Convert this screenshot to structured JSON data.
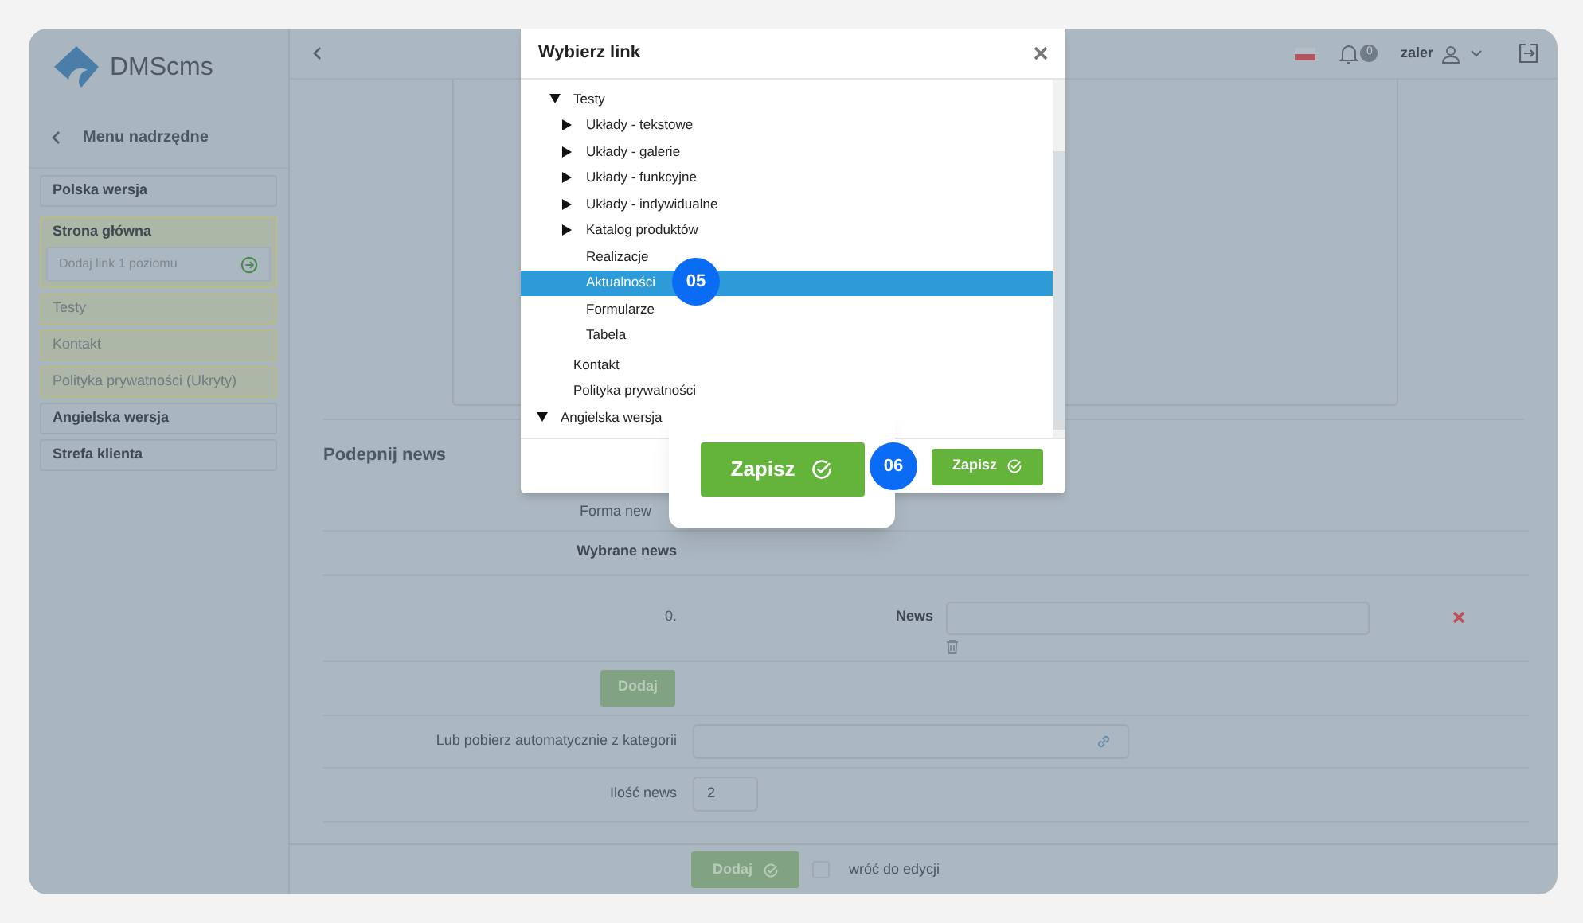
{
  "sidebar": {
    "logo": "DMScms",
    "back": "Menu nadrzędne",
    "items": [
      {
        "kind": "section",
        "label": "Polska wersja"
      },
      {
        "kind": "group",
        "label": "Strona główna",
        "field": {
          "placeholder": "Dodaj link 1 poziomu"
        }
      },
      {
        "kind": "page",
        "label": "Testy"
      },
      {
        "kind": "page",
        "label": "Kontakt"
      },
      {
        "kind": "page",
        "label": "Polityka prywatności (Ukryty)"
      },
      {
        "kind": "section",
        "label": "Angielska wersja"
      },
      {
        "kind": "section",
        "label": "Strefa klienta"
      }
    ]
  },
  "topbar": {
    "notifications": "0",
    "user": "zaler"
  },
  "form": {
    "title": "Podepnij news",
    "format_label": "Forma new",
    "selected_label": "Wybrane news",
    "row_index": "0.",
    "news_label": "News",
    "add_button": "Dodaj",
    "category_label": "Lub pobierz automatycznie z kategorii",
    "count_label": "Ilość news",
    "count_value": "2"
  },
  "footer": {
    "save_button": "Dodaj",
    "return_checkbox": {
      "label": "wróć do edycji",
      "checked": false
    }
  },
  "dialog": {
    "title": "Wybierz link",
    "tree": [
      {
        "children": [
          {
            "label": "Testy",
            "expanded": true,
            "selected": false,
            "children": [
              {
                "label": "Układy - tekstowe",
                "expanded": false,
                "selected": false
              },
              {
                "label": "Układy - galerie",
                "expanded": false,
                "selected": false
              },
              {
                "label": "Układy - funkcyjne",
                "expanded": false,
                "selected": false
              },
              {
                "label": "Układy - indywidualne",
                "expanded": false,
                "selected": false
              },
              {
                "label": "Katalog produktów",
                "expanded": false,
                "selected": false
              },
              {
                "label": "Realizacje",
                "selected": false
              },
              {
                "label": "Aktualności",
                "selected": true
              },
              {
                "label": "Formularze",
                "selected": false
              },
              {
                "label": "Tabela",
                "selected": false
              }
            ]
          },
          {
            "label": "Kontakt",
            "selected": false
          },
          {
            "label": "Polityka prywatności",
            "selected": false
          }
        ]
      },
      {
        "label": "Angielska wersja",
        "expanded": true,
        "selected": false
      }
    ],
    "save_button": "Zapisz"
  },
  "callout": {
    "save_button": "Zapisz"
  },
  "step_badges": [
    "05",
    "06"
  ]
}
